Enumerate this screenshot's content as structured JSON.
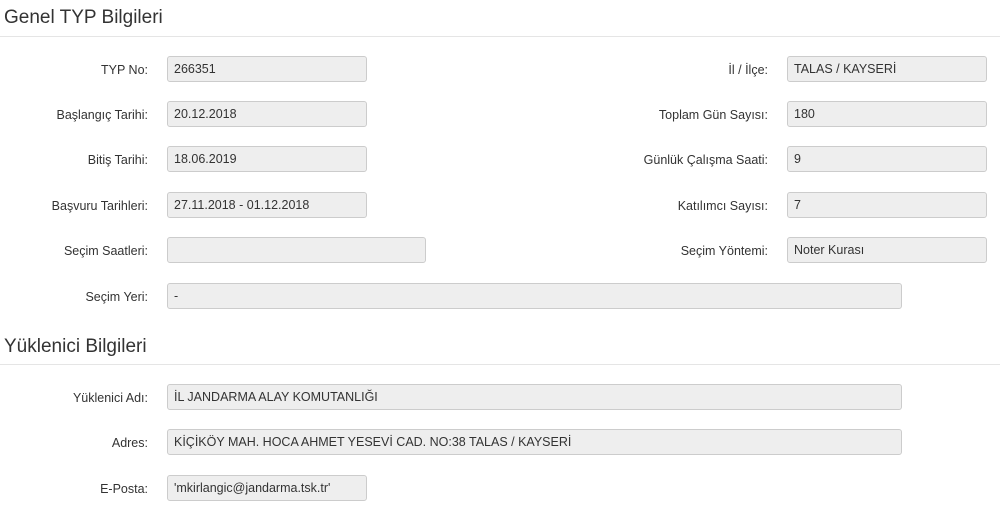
{
  "general": {
    "title": "Genel TYP Bilgileri",
    "typ_no": {
      "label": "TYP No:",
      "value": "266351"
    },
    "il_ilce": {
      "label": "İl / İlçe:",
      "value": "TALAS / KAYSERİ"
    },
    "baslangic": {
      "label": "Başlangıç Tarihi:",
      "value": "20.12.2018"
    },
    "toplam_gun": {
      "label": "Toplam Gün Sayısı:",
      "value": "180"
    },
    "bitis": {
      "label": "Bitiş Tarihi:",
      "value": "18.06.2019"
    },
    "gunluk_calisma": {
      "label": "Günlük Çalışma Saati:",
      "value": "9"
    },
    "basvuru": {
      "label": "Başvuru Tarihleri:",
      "value": "27.11.2018 - 01.12.2018"
    },
    "katilimci": {
      "label": "Katılımcı Sayısı:",
      "value": "7"
    },
    "secim_saatleri": {
      "label": "Seçim Saatleri:",
      "value": ""
    },
    "secim_yontemi": {
      "label": "Seçim Yöntemi:",
      "value": "Noter Kurası"
    },
    "secim_yeri": {
      "label": "Seçim Yeri:",
      "value": "-"
    }
  },
  "contractor": {
    "title": "Yüklenici Bilgileri",
    "adi": {
      "label": "Yüklenici Adı:",
      "value": "İL JANDARMA ALAY KOMUTANLIĞI"
    },
    "adres": {
      "label": "Adres:",
      "value": "KİÇİKÖY MAH. HOCA AHMET YESEVİ CAD. NO:38 TALAS / KAYSERİ"
    },
    "eposta": {
      "label": "E-Posta:",
      "value": "'mkirlangic@jandarma.tsk.tr'"
    }
  }
}
